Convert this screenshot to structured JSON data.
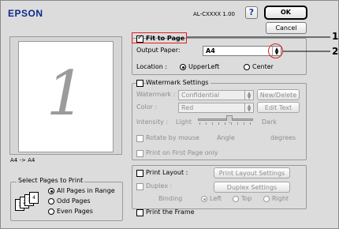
{
  "header": {
    "brand": "EPSON",
    "model": "AL-CXXXX 1.00",
    "help_label": "?",
    "ok_label": "OK",
    "cancel_label": "Cancel"
  },
  "preview": {
    "page_number": "1",
    "caption": "A4 -> A4"
  },
  "select_pages": {
    "title": "Select Pages to Print",
    "options": [
      "All Pages in Range",
      "Odd Pages",
      "Even Pages"
    ],
    "selected": "All Pages in Range",
    "icon_numbers": [
      "1",
      "2",
      "3",
      "4"
    ]
  },
  "fit": {
    "label": "Fit to Page",
    "checked": true,
    "output_paper_label": "Output Paper:",
    "output_paper_value": "A4",
    "location_label": "Location :",
    "location_options": [
      "UpperLeft",
      "Center"
    ],
    "location_selected": "UpperLeft"
  },
  "watermark": {
    "title": "Watermark Settings",
    "watermark_label": "Watermark :",
    "watermark_value": "Confidential",
    "new_delete_label": "New/Delete",
    "color_label": "Color :",
    "color_value": "Red",
    "edit_text_label": "Edit Text",
    "intensity_label": "Intensity :",
    "intensity_light": "Light",
    "intensity_dark": "Dark",
    "rotate_label": "Rotate by mouse",
    "angle_label": "Angle",
    "degrees_label": "degrees",
    "first_page_label": "Print on First Page only"
  },
  "print_layout": {
    "label": "Print Layout :",
    "settings_label": "Print Layout Settings",
    "duplex_label": "Duplex :",
    "duplex_settings_label": "Duplex Settings",
    "binding_label": "Binding",
    "binding_options": [
      "Left",
      "Top",
      "Right"
    ],
    "binding_selected": "Left",
    "frame_label": "Print the Frame"
  },
  "callouts": [
    "1",
    "2"
  ],
  "colors": {
    "callout": "#e02020",
    "dialog_bg": "#dcdcdc"
  }
}
